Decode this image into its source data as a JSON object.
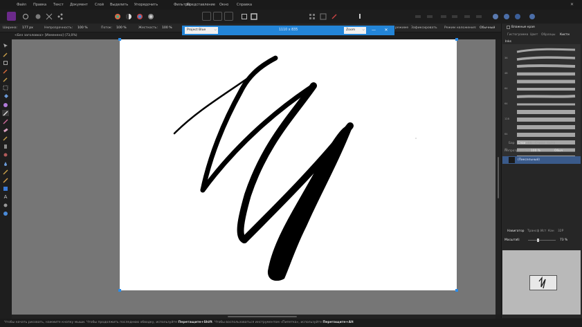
{
  "menu": {
    "items": [
      "Файл",
      "Правка",
      "Текст",
      "Документ",
      "Слой",
      "Выделить",
      "Упорядочить",
      "Фильтры",
      "Представление",
      "Окно",
      "Справка"
    ]
  },
  "context_bar": {
    "width_label": "Ширина:",
    "width_value": "177 рх",
    "opacity_label": "Непрозрачность:",
    "opacity_value": "100 %",
    "flow_label": "Поток:",
    "flow_value": "100 %",
    "hardness_label": "Жесткость:",
    "hardness_value": "100 %",
    "right_text1": "режиме",
    "right_text2": "Зафиксировать",
    "right_text3": "Режим наложения:",
    "right_text4": "Обычный"
  },
  "document_tab": {
    "title": "<Без заголовка> [Изменено] (73,0%)"
  },
  "float_bar": {
    "color_select": "Project Blue",
    "size_title": "1110 x 835",
    "zoom_select": "Zoom",
    "minimize": "—",
    "close": "✕"
  },
  "right_panel": {
    "top_check_label": "Влажные края",
    "tabs_top": [
      "Гистограмма",
      "Цвет",
      "Образцы",
      "Кисти"
    ],
    "brush_category": "Inks",
    "brush_sizes": [
      "",
      "36",
      "",
      "48",
      "",
      "64",
      "",
      "64",
      "",
      "128",
      "",
      "64",
      "",
      "32",
      ""
    ],
    "tabs_mid": [
      "Бар",
      "Слои",
      "FX",
      "Стили",
      "Бити"
    ],
    "opacity_label": "Непрозрачность:",
    "opacity_value": "100 %",
    "blend_value": "Обыч",
    "layer_name": "(Пиксельный)",
    "tabs_bottom": [
      "Навигатор",
      "Трансф",
      "Ист",
      "Кан",
      "32P"
    ],
    "zoom_label": "Масштаб:",
    "zoom_value": "73 %"
  },
  "status": {
    "part1": "Чтобы начать рисовать, нажмите кнопку мыши. Чтобы продолжить последнюю обводку, используйте ",
    "key1": "Перетащите+Shift",
    "part2": ". Чтобы воспользоваться инструментом «Пипетка», используйте ",
    "key2": "Перетащите+Alt"
  },
  "colors": {
    "accent": "#2385d8",
    "canvas_bg": "#767676",
    "ui_bg": "#262626"
  }
}
